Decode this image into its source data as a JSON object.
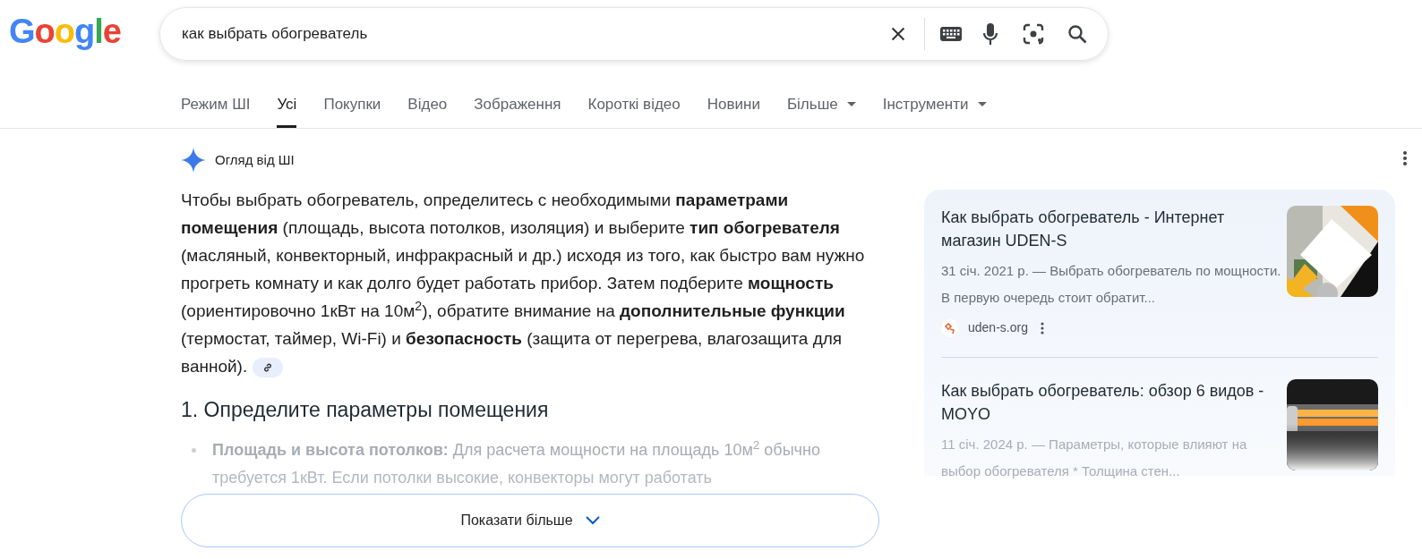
{
  "logo": {
    "text": "Google"
  },
  "search": {
    "value": "как выбрать обогреватель"
  },
  "tabs": [
    {
      "label": "Режим ШІ",
      "selected": false,
      "kind": "plain"
    },
    {
      "label": "Усі",
      "selected": true,
      "kind": "plain"
    },
    {
      "label": "Покупки",
      "selected": false,
      "kind": "plain"
    },
    {
      "label": "Відео",
      "selected": false,
      "kind": "plain"
    },
    {
      "label": "Зображення",
      "selected": false,
      "kind": "plain"
    },
    {
      "label": "Короткі відео",
      "selected": false,
      "kind": "plain"
    },
    {
      "label": "Новини",
      "selected": false,
      "kind": "plain"
    },
    {
      "label": "Більше",
      "selected": false,
      "kind": "menu"
    },
    {
      "label": "Інструменти",
      "selected": false,
      "kind": "menu"
    }
  ],
  "ai_overview": {
    "label": "Огляд від ШІ",
    "summary": "Чтобы выбрать обогреватель, определитесь с необходимыми **параметрами помещения** (площадь, высота потолков, изоляция) и выберите **тип обогревателя** (масляный, конвекторный, инфракрасный и др.) исходя из того, как быстро вам нужно прогреть комнату и как долго будет работать прибор. Затем подберите **мощность** (ориентировочно 1кВт на 10м$^{2}$), обратите внимание на **дополнительные функции** (термостат, таймер, Wi-Fi) и **безопасность** (защита от перегрева, влагозащита для ванной).",
    "heading": "1. Определите параметры помещения",
    "bullet_lines": [
      "**Площадь и высота потолков:** Для расчета мощности на площадь 10м$^{2}$ обычно",
      "требуется 1кВт. Если потолки высокие, конвекторы могут работать"
    ],
    "show_more": "Показати більше"
  },
  "sources": [
    {
      "title": "Как выбрать обогреватель - Интернет магазин UDEN-S",
      "snippet": "31 січ. 2021 р. — Выбрать обогреватель по мощности. В первую очередь стоит обратит...",
      "site": "uden-s.org",
      "faded": false
    },
    {
      "title": "Как выбрать обогреватель: обзор 6 видов - MOYO",
      "snippet": "11 січ. 2024 р. — Параметры, которые влияют на выбор обогревателя * Толщина стен...",
      "faded": true
    }
  ]
}
